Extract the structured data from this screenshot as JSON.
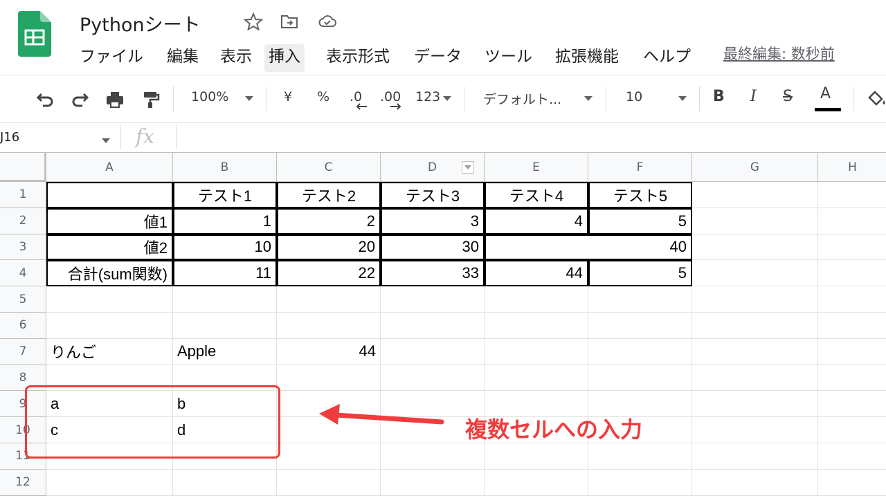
{
  "app": {
    "doc_title": "Pythonシート",
    "last_edit": "最終編集: 数秒前",
    "brand_color": "#23a566"
  },
  "menu": [
    "ファイル",
    "編集",
    "表示",
    "挿入",
    "表示形式",
    "データ",
    "ツール",
    "拡張機能",
    "ヘルプ"
  ],
  "toolbar": {
    "zoom": "100%",
    "currency": "¥",
    "percent": "%",
    "decimal_decrease": ".0",
    "decimal_increase": ".00",
    "format_more": "123",
    "font": "デフォルト...",
    "font_size": "10",
    "bold": "B",
    "italic": "I",
    "strike": "S",
    "text_color": "A"
  },
  "formula_bar": {
    "name_box": "J16",
    "fx": "fx",
    "value": ""
  },
  "grid": {
    "columns": [
      "A",
      "B",
      "C",
      "D",
      "E",
      "F",
      "G",
      "H"
    ],
    "rows": [
      "1",
      "2",
      "3",
      "4",
      "5",
      "6",
      "7",
      "8",
      "9",
      "10",
      "11",
      "12"
    ],
    "table": {
      "headers": [
        "",
        "テスト1",
        "テスト2",
        "テスト3",
        "テスト4",
        "テスト5"
      ],
      "row2": [
        "値1",
        "1",
        "2",
        "3",
        "4",
        "5"
      ],
      "row3": [
        "値2",
        "10",
        "20",
        "30",
        "40"
      ],
      "row4": [
        "合計(sum関数)",
        "11",
        "22",
        "33",
        "44",
        "5"
      ]
    },
    "row7": [
      "りんご",
      "Apple",
      "44"
    ],
    "row9": [
      "a",
      "b"
    ],
    "row10": [
      "c",
      "d"
    ]
  },
  "annotation": {
    "text": "複数セルへの入力",
    "color": "#f03c3c"
  }
}
